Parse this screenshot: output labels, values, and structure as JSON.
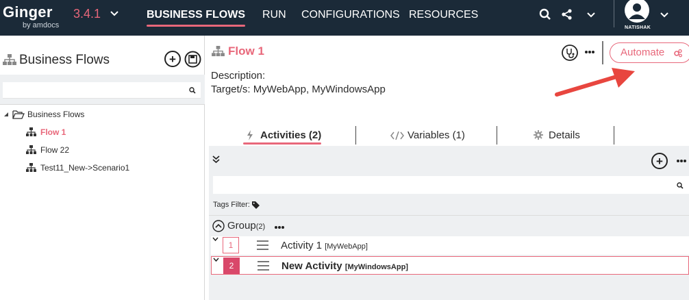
{
  "app": {
    "logo": "Ginger",
    "logo_sub": "by amdocs",
    "version": "3.4.1"
  },
  "nav": {
    "items": [
      {
        "label": "BUSINESS FLOWS"
      },
      {
        "label": "RUN"
      },
      {
        "label": "CONFIGURATIONS"
      },
      {
        "label": "RESOURCES"
      }
    ],
    "user": "NATISHAK"
  },
  "left_pane": {
    "title": "Business Flows",
    "search_value": "",
    "tree": {
      "root": "Business Flows",
      "items": [
        {
          "label": "Flow 1",
          "selected": true
        },
        {
          "label": "Flow 22",
          "selected": false
        },
        {
          "label": "Test11_New->Scenario1",
          "selected": false
        }
      ]
    }
  },
  "main": {
    "flow_title": "Flow 1",
    "description": "Description:",
    "targets": "Target/s: MyWebApp, MyWindowsApp",
    "automate_label": "Automate",
    "tabs": [
      {
        "label": "Activities (2)",
        "active": true
      },
      {
        "label": "Variables (1)",
        "active": false
      },
      {
        "label": "Details",
        "active": false
      }
    ],
    "activities": {
      "search_value": "",
      "tags_filter": "Tags Filter:",
      "group_label": "Group",
      "group_count": "(2)",
      "rows": [
        {
          "num": "1",
          "name": "Activity 1",
          "target": "[MyWebApp]",
          "selected": false
        },
        {
          "num": "2",
          "name": "New Activity",
          "target": "[MyWindowsApp]",
          "selected": true
        }
      ]
    }
  },
  "colors": {
    "accent": "#e8677a",
    "topbar": "#1b2a38",
    "arrow": "#e8463f"
  }
}
